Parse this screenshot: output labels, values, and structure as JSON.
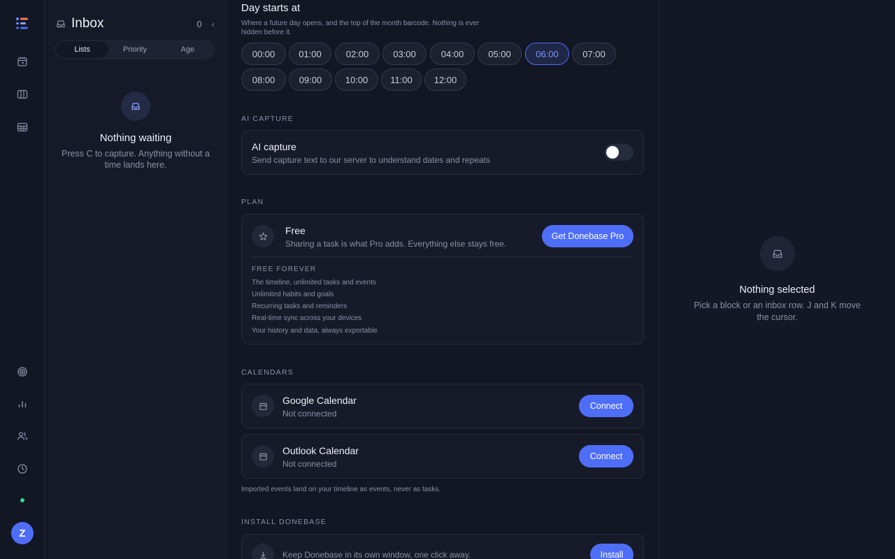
{
  "rail": {
    "logo": "app-logo",
    "nav_icons": [
      "calendar-icon",
      "columns-icon",
      "table-icon"
    ],
    "bottom_icons": [
      "target-icon",
      "bar-chart-icon",
      "users-icon",
      "clock-icon"
    ],
    "status_color": "#34d399",
    "avatar_initial": "Z"
  },
  "inbox": {
    "title": "Inbox",
    "count": "0",
    "collapse_glyph": "‹",
    "tabs": [
      "Lists",
      "Priority",
      "Age"
    ],
    "active_tab": "Lists",
    "empty_title": "Nothing waiting",
    "empty_text": "Press C to capture. Anything without a time lands here."
  },
  "settings": {
    "day_start": {
      "title": "Day starts at",
      "description": "Where a future day opens, and the top of the month barcode. Nothing is ever hidden before it.",
      "options": [
        "00:00",
        "01:00",
        "02:00",
        "03:00",
        "04:00",
        "05:00",
        "06:00",
        "07:00",
        "08:00",
        "09:00",
        "10:00",
        "11:00",
        "12:00"
      ],
      "selected": "06:00"
    },
    "ai_capture": {
      "section_label": "AI CAPTURE",
      "title": "AI capture",
      "description": "Send capture text to our server to understand dates and repeats",
      "enabled": false
    },
    "plan": {
      "section_label": "PLAN",
      "name": "Free",
      "description": "Sharing a task is what Pro adds. Everything else stays free.",
      "upgrade_label": "Get Donebase Pro",
      "features_label": "FREE FOREVER",
      "features": [
        "The timeline, unlimited tasks and events",
        "Unlimited habits and goals",
        "Recurring tasks and reminders",
        "Real-time sync across your devices",
        "Your history and data, always exportable"
      ]
    },
    "calendars": {
      "section_label": "CALENDARS",
      "items": [
        {
          "name": "Google Calendar",
          "status": "Not connected",
          "action": "Connect"
        },
        {
          "name": "Outlook Calendar",
          "status": "Not connected",
          "action": "Connect"
        }
      ],
      "footnote": "Imported events land on your timeline as events, never as tasks."
    },
    "install": {
      "section_label": "INSTALL DONEBASE",
      "description": "Keep Donebase in its own window, one click away.",
      "action": "Install"
    }
  },
  "detail": {
    "empty_title": "Nothing selected",
    "empty_text": "Pick a block or an inbox row. J and K move the cursor."
  },
  "colors": {
    "accent": "#4f6ef7",
    "background": "#141826",
    "card": "#171b29"
  }
}
